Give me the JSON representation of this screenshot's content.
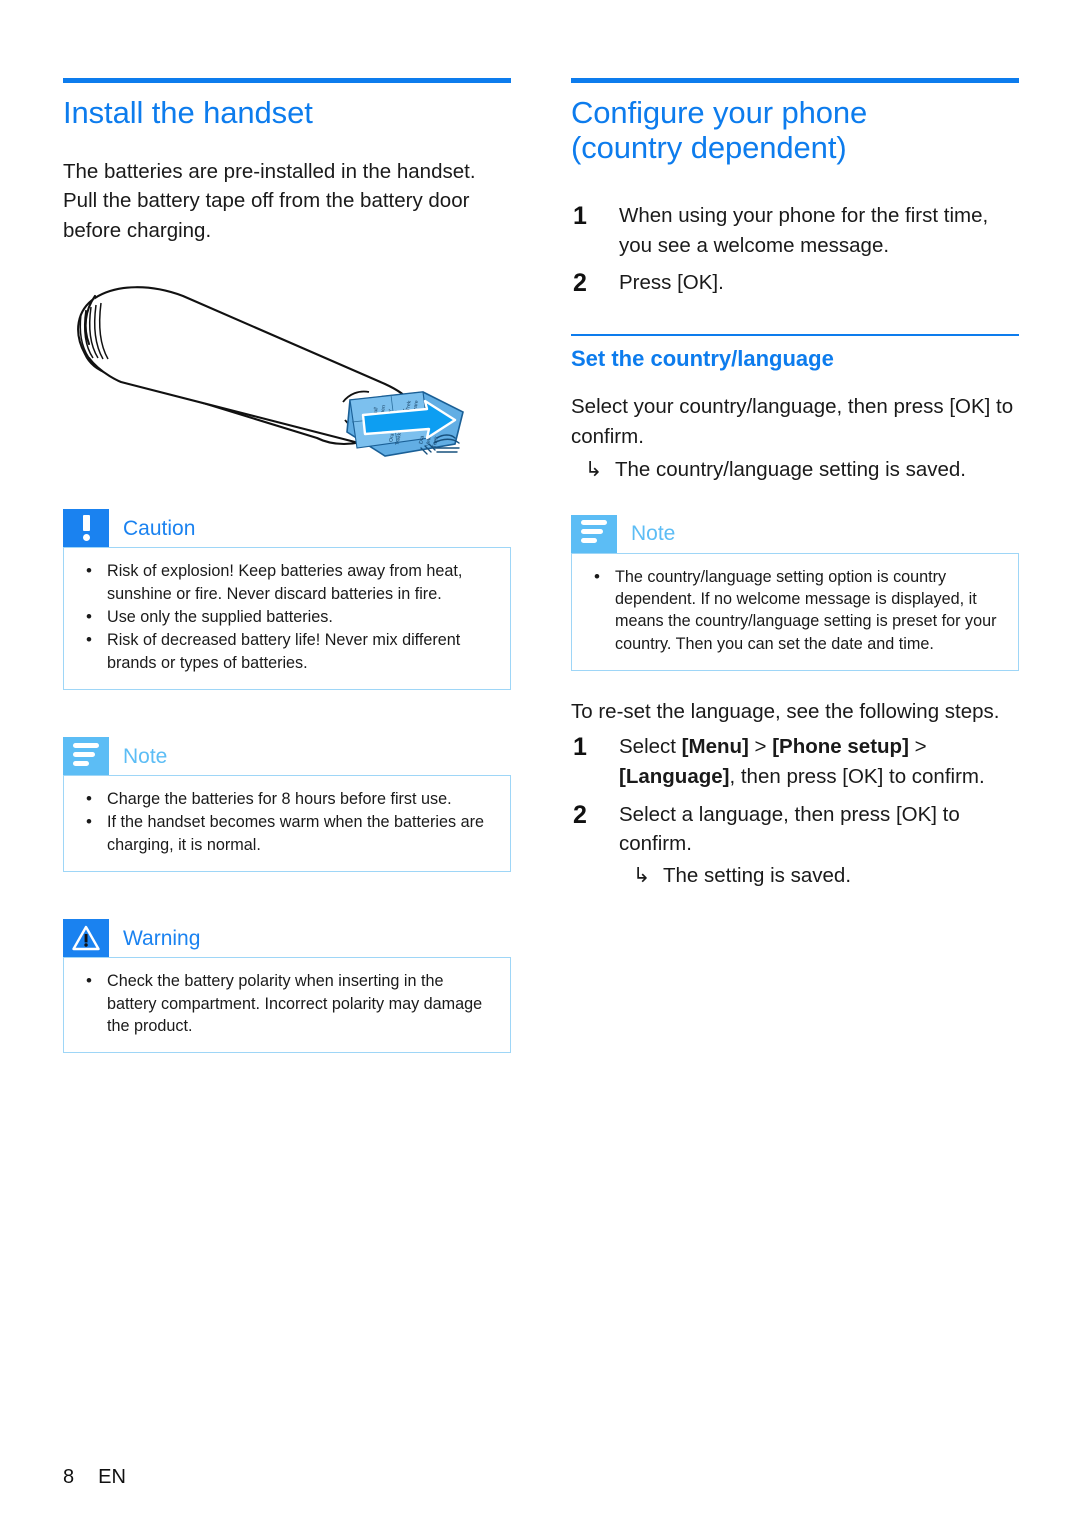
{
  "left": {
    "heading": "Install the handset",
    "intro": "The batteries are pre-installed in the handset. Pull the battery tape off from the battery door before charging.",
    "illustration": {
      "alt_name": "handset-battery-tape-illustration",
      "tab_labels": [
        "Pull",
        "Ziehen",
        "Tirer",
        "Tirar",
        "Retirar",
        "Puxar",
        "Trek",
        "Tirare",
        "Ora",
        "Trekk",
        "Dra",
        "Veta",
        "Træk"
      ],
      "tab_color": "#3a9ae8",
      "arrow_color": "#0d9ef2"
    },
    "callouts": [
      {
        "type": "caution",
        "label": "Caution",
        "icon": "exclamation-icon",
        "items": [
          "Risk of explosion! Keep batteries away from heat, sunshine or fire. Never discard batteries in fire.",
          "Use only the supplied batteries.",
          "Risk of decreased battery life! Never mix different brands or types of batteries."
        ]
      },
      {
        "type": "note",
        "label": "Note",
        "icon": "note-lines-icon",
        "items": [
          "Charge the batteries for 8 hours before first use.",
          "If the handset becomes warm when the batteries are charging, it is normal."
        ]
      },
      {
        "type": "warning",
        "label": "Warning",
        "icon": "warning-triangle-icon",
        "items": [
          "Check the battery polarity when inserting in the battery compartment. Incorrect polarity may damage the product."
        ]
      }
    ]
  },
  "right": {
    "heading_line1": "Configure your phone",
    "heading_line2": "(country dependent)",
    "steps": [
      {
        "num": "1",
        "text": "When using your phone for the first time, you see a welcome message."
      },
      {
        "num": "2",
        "text": "Press [OK]."
      }
    ],
    "subheading": "Set the country/language",
    "intro": "Select your country/language, then press [OK] to confirm.",
    "intro_result": "The country/language setting is saved.",
    "callout": {
      "type": "note",
      "label": "Note",
      "icon": "note-lines-icon",
      "items": [
        "The country/language setting option is country dependent. If no welcome message is displayed, it means the country/language setting is preset for your country. Then you can set the date and time."
      ]
    },
    "reset_intro": "To re-set the language, see the following steps.",
    "reset_steps": [
      {
        "num": "1",
        "text_parts": [
          "Select ",
          "[Menu]",
          " > ",
          "[Phone setup]",
          " > ",
          "[Language]",
          ", then press ",
          "[OK]",
          " to confirm."
        ]
      },
      {
        "num": "2",
        "text_parts": [
          "Select a language, then press ",
          "[OK]",
          " to confirm."
        ]
      }
    ],
    "reset_result": "The setting is saved."
  },
  "footer": {
    "page_number": "8",
    "language_code": "EN"
  },
  "colors": {
    "heading_blue": "#0d7ced",
    "note_blue": "#5cbdf5",
    "box_border": "#9ed6f7",
    "text": "#1a1a1a"
  },
  "symbols": {
    "result_arrow": "↳",
    "bullet": "•"
  }
}
